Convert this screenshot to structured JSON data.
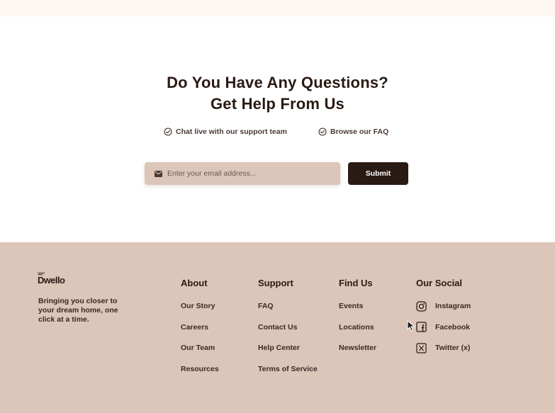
{
  "cta": {
    "title_line1": "Do You Have Any Questions?",
    "title_line2": "Get Help From Us",
    "features": [
      {
        "label": "Chat live with our support team",
        "icon": "check-circle-icon"
      },
      {
        "label": "Browse our FAQ",
        "icon": "check-circle-icon"
      }
    ],
    "email_placeholder": "Enter your email address...",
    "email_icon": "mail-icon",
    "submit_label": "Submit"
  },
  "footer": {
    "logo_text": "Dwello",
    "tagline": "Bringing you closer to your dream home, one click at a time.",
    "columns": {
      "about": {
        "title": "About",
        "items": [
          "Our Story",
          "Careers",
          "Our Team",
          "Resources"
        ]
      },
      "support": {
        "title": "Support",
        "items": [
          "FAQ",
          "Contact Us",
          "Help Center",
          "Terms of Service"
        ]
      },
      "find": {
        "title": "Find Us",
        "items": [
          "Events",
          "Locations",
          "Newsletter"
        ]
      },
      "social": {
        "title": "Our Social",
        "items": [
          {
            "label": "Instagram",
            "icon": "instagram-icon"
          },
          {
            "label": "Facebook",
            "icon": "facebook-icon"
          },
          {
            "label": "Twitter (x)",
            "icon": "x-twitter-icon"
          }
        ]
      }
    }
  },
  "colors": {
    "top_band": "#fdf6f1",
    "dark_brown": "#2a1a14",
    "footer_bg": "#dcc5b9",
    "input_bg": "#dcc5b9"
  }
}
